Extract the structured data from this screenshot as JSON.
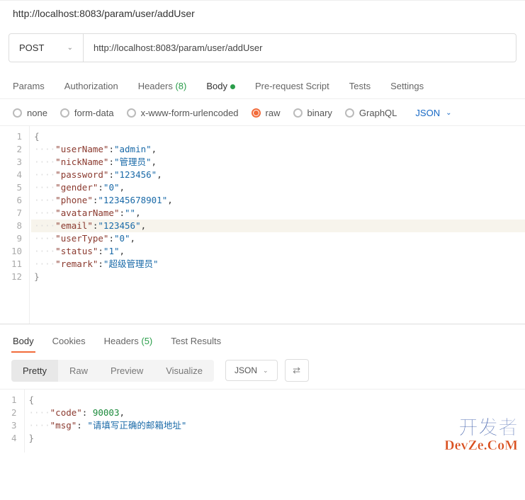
{
  "header": {
    "title": "http://localhost:8083/param/user/addUser"
  },
  "request": {
    "method": "POST",
    "url": "http://localhost:8083/param/user/addUser"
  },
  "tabs": {
    "params": "Params",
    "authorization": "Authorization",
    "headers_label": "Headers",
    "headers_count": "(8)",
    "body": "Body",
    "prerequest": "Pre-request Script",
    "tests": "Tests",
    "settings": "Settings"
  },
  "body_types": {
    "none": "none",
    "formdata": "form-data",
    "xwww": "x-www-form-urlencoded",
    "raw": "raw",
    "binary": "binary",
    "graphql": "GraphQL",
    "json": "JSON"
  },
  "request_body": {
    "lines": [
      {
        "n": 1,
        "type": "brace",
        "text": "{"
      },
      {
        "n": 2,
        "type": "kv",
        "key": "userName",
        "value": "admin",
        "vtype": "str",
        "comma": true
      },
      {
        "n": 3,
        "type": "kv",
        "key": "nickName",
        "value": "管理员",
        "vtype": "str",
        "comma": true
      },
      {
        "n": 4,
        "type": "kv",
        "key": "password",
        "value": "123456",
        "vtype": "str",
        "comma": true
      },
      {
        "n": 5,
        "type": "kv",
        "key": "gender",
        "value": "0",
        "vtype": "str",
        "comma": true
      },
      {
        "n": 6,
        "type": "kv",
        "key": "phone",
        "value": "12345678901",
        "vtype": "str",
        "comma": true
      },
      {
        "n": 7,
        "type": "kv",
        "key": "avatarName",
        "value": "",
        "vtype": "str",
        "comma": true
      },
      {
        "n": 8,
        "type": "kv",
        "key": "email",
        "value": "123456",
        "vtype": "str",
        "comma": true,
        "highlight": true
      },
      {
        "n": 9,
        "type": "kv",
        "key": "userType",
        "value": "0",
        "vtype": "str",
        "comma": true
      },
      {
        "n": 10,
        "type": "kv",
        "key": "status",
        "value": "1",
        "vtype": "str",
        "comma": true
      },
      {
        "n": 11,
        "type": "kv",
        "key": "remark",
        "value": "超级管理员",
        "vtype": "str",
        "comma": false
      },
      {
        "n": 12,
        "type": "brace",
        "text": "}"
      }
    ]
  },
  "response_tabs": {
    "body": "Body",
    "cookies": "Cookies",
    "headers_label": "Headers",
    "headers_count": "(5)",
    "test_results": "Test Results"
  },
  "view_modes": {
    "pretty": "Pretty",
    "raw": "Raw",
    "preview": "Preview",
    "visualize": "Visualize",
    "format": "JSON"
  },
  "response_body": {
    "lines": [
      {
        "n": 1,
        "type": "brace",
        "text": "{"
      },
      {
        "n": 2,
        "type": "kv",
        "key": "code",
        "value": "90003",
        "vtype": "num",
        "comma": true,
        "space": true
      },
      {
        "n": 3,
        "type": "kv",
        "key": "msg",
        "value": "请填写正确的邮箱地址",
        "vtype": "str",
        "comma": false,
        "space": true
      },
      {
        "n": 4,
        "type": "brace",
        "text": "}"
      }
    ]
  },
  "watermark": {
    "line1": "开发者",
    "line2": "DevZe.CoM"
  }
}
